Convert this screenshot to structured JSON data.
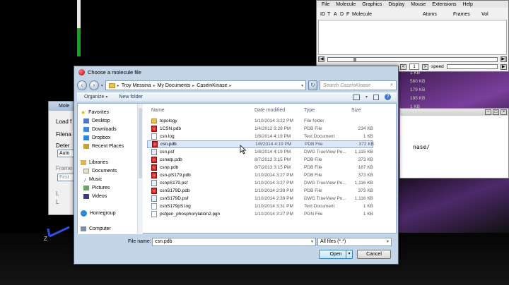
{
  "vmd_main": {
    "menu": [
      "File",
      "Molecule",
      "Graphics",
      "Display",
      "Mouse",
      "Extensions",
      "Help"
    ],
    "columns": [
      "ID",
      "T",
      "A",
      "D",
      "F",
      "Molecule",
      "Atoms",
      "Frames",
      "Vol"
    ],
    "frame_value": "1",
    "speed_label": "speed"
  },
  "bg_sizes": [
    "1 KB",
    "560 KB",
    "179 KB",
    "195 KB",
    "1 KB"
  ],
  "terminal": {
    "text": "nase/"
  },
  "mol_win": {
    "title": "Mole",
    "load_label": "Load f",
    "filename_label": "Filena",
    "determine_label": "Deter",
    "auto_value": "Auto",
    "frames_label": "Frame",
    "first_label": "First",
    "l1": "L",
    "l2": "L"
  },
  "axis_z_label": "Z",
  "dialog": {
    "title": "Choose a molecule file",
    "breadcrumb": [
      "Troy Messina",
      "My Documents",
      "CaseinKinase"
    ],
    "search_placeholder": "Search CaseinKinase",
    "toolbar": {
      "organize": "Organize",
      "new_folder": "New folder"
    },
    "nav": {
      "favorites": "Favorites",
      "desktop": "Desktop",
      "downloads": "Downloads",
      "dropbox": "Dropbox",
      "recent": "Recent Places",
      "libraries": "Libraries",
      "documents": "Documents",
      "music": "Music",
      "pictures": "Pictures",
      "videos": "Videos",
      "homegroup": "Homegroup",
      "computer": "Computer"
    },
    "headers": {
      "name": "Name",
      "date": "Date modified",
      "type": "Type",
      "size": "Size"
    },
    "files": [
      {
        "name": "topology",
        "date": "1/10/2014 3:22 PM",
        "type": "File folder",
        "size": ""
      },
      {
        "name": "1CSN.pdb",
        "date": "1/4/2012 3:28 PM",
        "type": "PDB File",
        "size": "234 KB"
      },
      {
        "name": "csn.log",
        "date": "1/8/2014 4:19 PM",
        "type": "Text Document",
        "size": "1 KB"
      },
      {
        "name": "csn.pdb",
        "date": "1/8/2014 4:19 PM",
        "type": "PDB File",
        "size": "372 KB"
      },
      {
        "name": "csn.psf",
        "date": "1/8/2014 4:19 PM",
        "type": "DWG TrueView Po...",
        "size": "1,115 KB"
      },
      {
        "name": "csnatp.pdb",
        "date": "8/7/2013 3:15 PM",
        "type": "PDB File",
        "size": "373 KB"
      },
      {
        "name": "csnp.pdb",
        "date": "8/7/2013 3:15 PM",
        "type": "PDB File",
        "size": "187 KB"
      },
      {
        "name": "csn-pS179.pdb",
        "date": "1/10/2014 3:27 PM",
        "type": "PDB File",
        "size": "373 KB"
      },
      {
        "name": "csnpS179.psf",
        "date": "1/10/2014 3:27 PM",
        "type": "DWG TrueView Po...",
        "size": "1,116 KB"
      },
      {
        "name": "csnS179D.pdb",
        "date": "1/10/2014 2:39 PM",
        "type": "PDB File",
        "size": "373 KB"
      },
      {
        "name": "csnS179D.psf",
        "date": "1/10/2014 2:39 PM",
        "type": "DWG TrueView Po...",
        "size": "1,116 KB"
      },
      {
        "name": "csnS179pS.log",
        "date": "1/10/2014 3:31 PM",
        "type": "Text Document",
        "size": "1 KB"
      },
      {
        "name": "psfgen_phosphorylation2.pgn",
        "date": "1/10/2014 3:27 PM",
        "type": "PGN File",
        "size": "1 KB"
      }
    ],
    "filename_label": "File name:",
    "filename_value": "csn.pdb",
    "filetype_value": "All files (*.*)",
    "open_label": "Open",
    "cancel_label": "Cancel"
  }
}
